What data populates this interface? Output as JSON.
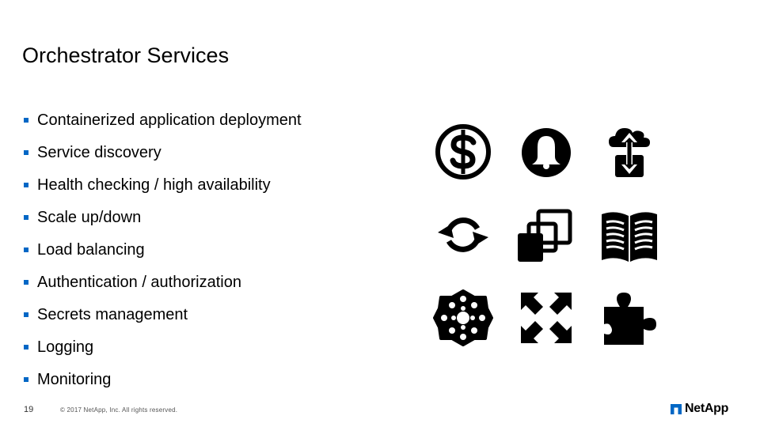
{
  "slide": {
    "title": "Orchestrator Services",
    "bullet_color": "#0067C5",
    "bullets": [
      "Containerized application deployment",
      "Service discovery",
      "Health checking / high availability",
      "Scale up/down",
      "Load balancing",
      "Authentication / authorization",
      "Secrets management",
      "Logging",
      "Monitoring"
    ],
    "icons": [
      "dollar-circle-icon",
      "bell-circle-icon",
      "cloud-transfer-icon",
      "refresh-icon",
      "overlapping-squares-icon",
      "open-book-icon",
      "network-cluster-icon",
      "expand-arrows-icon",
      "puzzle-piece-icon"
    ]
  },
  "footer": {
    "page_number": "19",
    "copyright": "© 2017 NetApp, Inc. All rights reserved.",
    "logo_text": "NetApp",
    "logo_color": "#0067C5"
  }
}
